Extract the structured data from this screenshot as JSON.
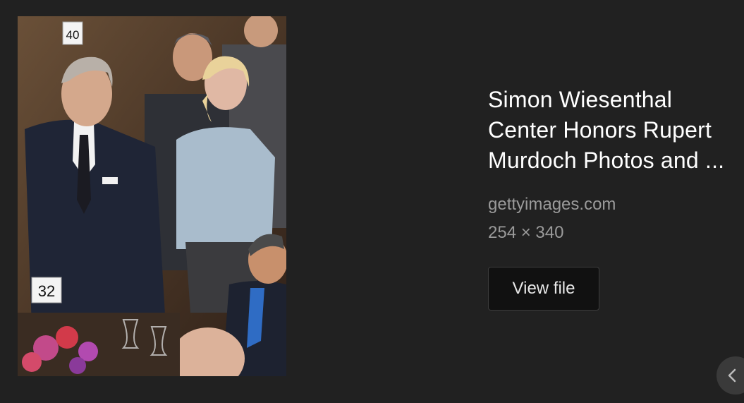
{
  "image": {
    "alt_icon": "photo",
    "table_numbers": [
      "40",
      "32"
    ]
  },
  "result": {
    "title": "Simon Wiesenthal Center Honors Rupert Murdoch Photos and ...",
    "source": "gettyimages.com",
    "dimensions": "254 × 340",
    "view_file_label": "View file"
  },
  "nav": {
    "prev_icon": "chevron-left-icon"
  },
  "colors": {
    "background": "#212121",
    "button": "#111111",
    "muted_text": "#9a9a9a"
  }
}
